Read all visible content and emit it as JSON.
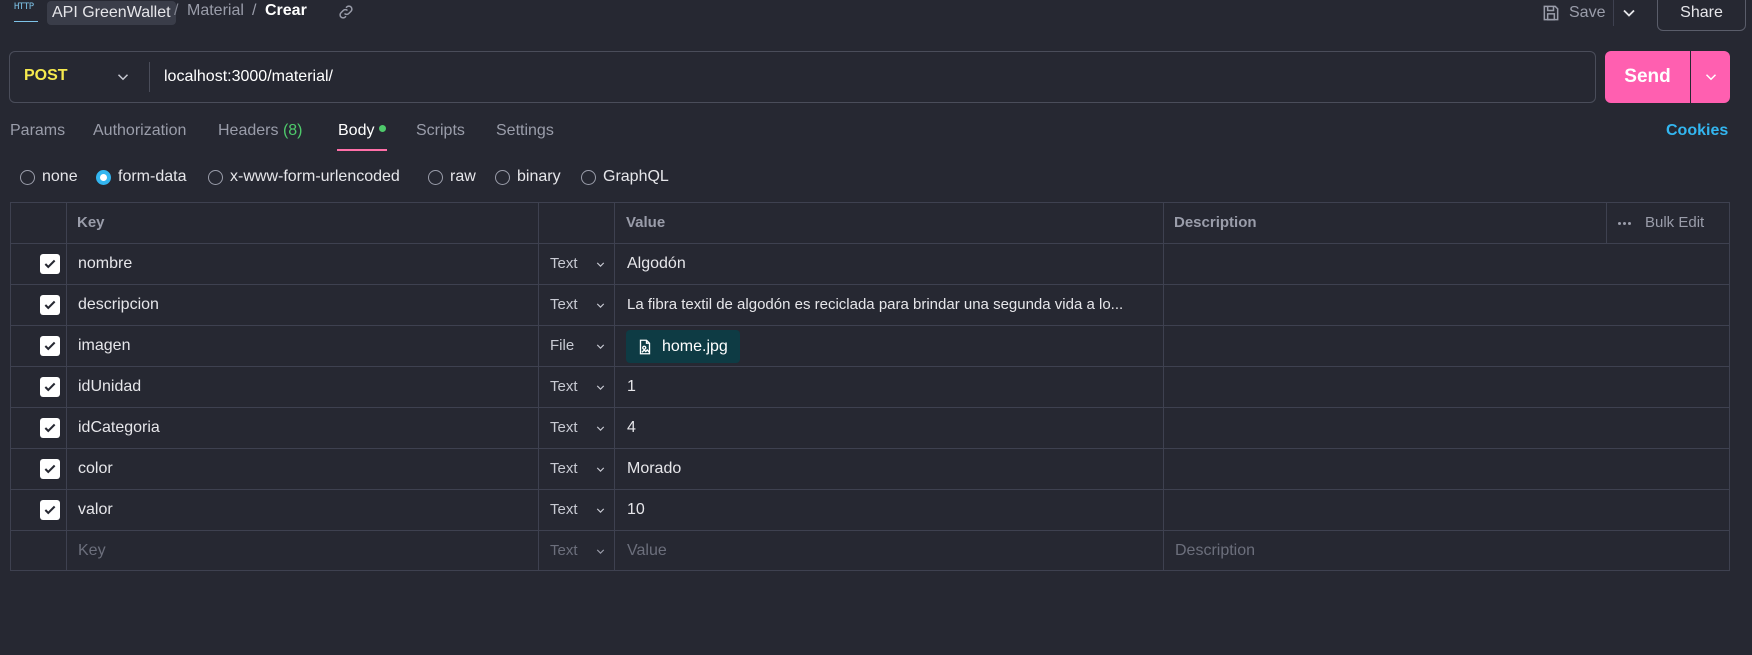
{
  "breadcrumb": {
    "http_badge": "HTTP",
    "collection": "API GreenWallet",
    "folder": "Material",
    "separator": "/",
    "current": "Crear"
  },
  "toolbar": {
    "save_label": "Save",
    "share_label": "Share"
  },
  "request": {
    "method": "POST",
    "url": "localhost:3000/material/",
    "send_label": "Send"
  },
  "tabs": [
    {
      "label": "Params"
    },
    {
      "label": "Authorization"
    },
    {
      "label": "Headers",
      "count": "(8)"
    },
    {
      "label": "Body",
      "dot": true
    },
    {
      "label": "Scripts"
    },
    {
      "label": "Settings"
    }
  ],
  "cookies_label": "Cookies",
  "body_types": [
    {
      "label": "none",
      "selected": false
    },
    {
      "label": "form-data",
      "selected": true
    },
    {
      "label": "x-www-form-urlencoded",
      "selected": false
    },
    {
      "label": "raw",
      "selected": false
    },
    {
      "label": "binary",
      "selected": false
    },
    {
      "label": "GraphQL",
      "selected": false
    }
  ],
  "table": {
    "headers": {
      "key": "Key",
      "value": "Value",
      "description": "Description",
      "bulk_edit": "Bulk Edit"
    },
    "rows": [
      {
        "checked": true,
        "key": "nombre",
        "type": "Text",
        "value": "Algodón",
        "description": ""
      },
      {
        "checked": true,
        "key": "descripcion",
        "type": "Text",
        "value": "La fibra textil de algodón es reciclada para brindar una segunda vida a lo...",
        "description": ""
      },
      {
        "checked": true,
        "key": "imagen",
        "type": "File",
        "value": "home.jpg",
        "description": ""
      },
      {
        "checked": true,
        "key": "idUnidad",
        "type": "Text",
        "value": "1",
        "description": ""
      },
      {
        "checked": true,
        "key": "idCategoria",
        "type": "Text",
        "value": "4",
        "description": ""
      },
      {
        "checked": true,
        "key": "color",
        "type": "Text",
        "value": "Morado",
        "description": ""
      },
      {
        "checked": true,
        "key": "valor",
        "type": "Text",
        "value": "10",
        "description": ""
      }
    ],
    "empty_row": {
      "key": "Key",
      "type": "Text",
      "value": "Value",
      "description": "Description"
    }
  },
  "colors": {
    "background": "#262832",
    "accent_send": "#ff5fb0",
    "method_post": "#f5e94e",
    "cookies_link": "#33b6f0",
    "count_green": "#4ec96b",
    "file_chip": "#0e3b44"
  }
}
